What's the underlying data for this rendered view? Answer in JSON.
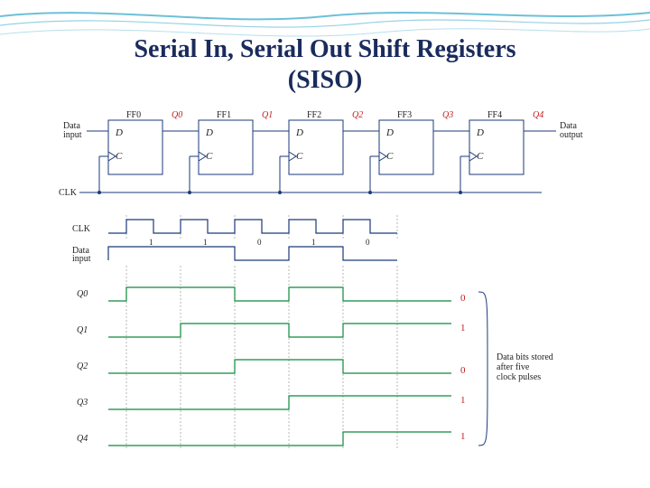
{
  "title_line1": "Serial In, Serial Out Shift Registers",
  "title_line2": "(SISO)",
  "circuit": {
    "data_input_label": "Data\ninput",
    "data_output_label": "Data\noutput",
    "clk_label": "CLK",
    "ff_names": [
      "FF0",
      "FF1",
      "FF2",
      "FF3",
      "FF4"
    ],
    "q_taps": [
      "Q0",
      "Q1",
      "Q2",
      "Q3",
      "Q4"
    ],
    "pin_d": "D",
    "pin_c": "C",
    "clk_tri": "▷"
  },
  "timing": {
    "clk_label": "CLK",
    "data_label": "Data\ninput",
    "row_labels": [
      "Q0",
      "Q1",
      "Q2",
      "Q3",
      "Q4"
    ],
    "data_values": [
      "1",
      "1",
      "0",
      "1",
      "0"
    ],
    "stored_bits": [
      "0",
      "1",
      "0",
      "1",
      "1"
    ],
    "caption": "Data bits stored\nafter five\nclock pulses"
  }
}
